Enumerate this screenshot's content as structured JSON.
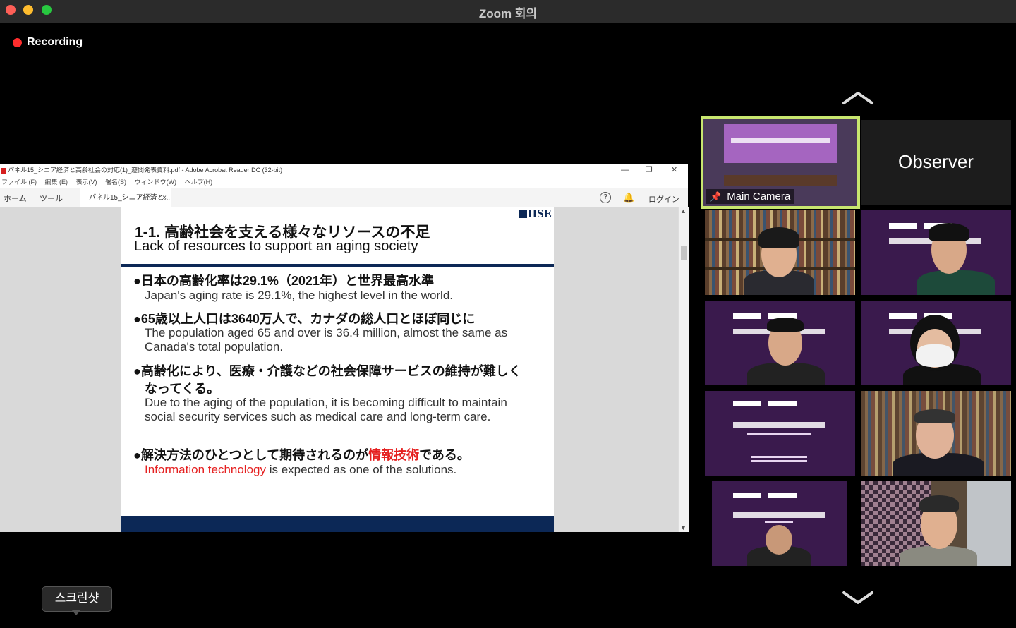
{
  "window": {
    "title": "Zoom 회의"
  },
  "recording": {
    "label": "Recording"
  },
  "acrobat": {
    "title": "パネル15_シニア経済と高齢社会の対応(1)_遊間発表資料.pdf - Adobe Acrobat Reader DC (32-bit)",
    "menu": [
      "ファイル (F)",
      "編集 (E)",
      "表示(V)",
      "署名(S)",
      "ウィンドウ(W)",
      "ヘルプ(H)"
    ],
    "tabs": {
      "home": "ホーム",
      "tools": "ツール",
      "doc": "パネル15_シニア経済と...",
      "doc_close": "×"
    },
    "help": "?",
    "login": "ログイン"
  },
  "slide": {
    "logo": "IISE",
    "heading_ja": "1-1. 高齢社会を支える様々なリソースの不足",
    "heading_en": "Lack of resources to support an aging society",
    "bullets": [
      {
        "ja": "●日本の高齢化率は29.1%（2021年）と世界最高水準",
        "en": "Japan's aging rate is 29.1%, the highest level in the world."
      },
      {
        "ja": "●65歳以上人口は3640万人で、カナダの総人口とほぼ同じに",
        "en": "The population aged 65 and over is 36.4 million, almost the same as Canada's total population."
      },
      {
        "ja1": "●高齢化により、医療・介護などの社会保障サービスの維持が難しく",
        "ja2": "なってくる。",
        "en": "Due to the aging of the population, it is becoming difficult to maintain social security services such as medical care and long-term care."
      },
      {
        "ja_pre": "●解決方法のひとつとして期待されるのが",
        "ja_red": "情報技術",
        "ja_post": "である。",
        "en_red": "Information technology",
        "en_post": " is expected as one of the solutions."
      }
    ]
  },
  "gallery": {
    "main_camera": "Main Camera",
    "observer": "Observer"
  },
  "tooltip": {
    "label": "스크린샷"
  },
  "colors": {
    "active_border": "#c8e66f",
    "slide_navy": "#0c2856",
    "recording_red": "#ff2d2d"
  }
}
